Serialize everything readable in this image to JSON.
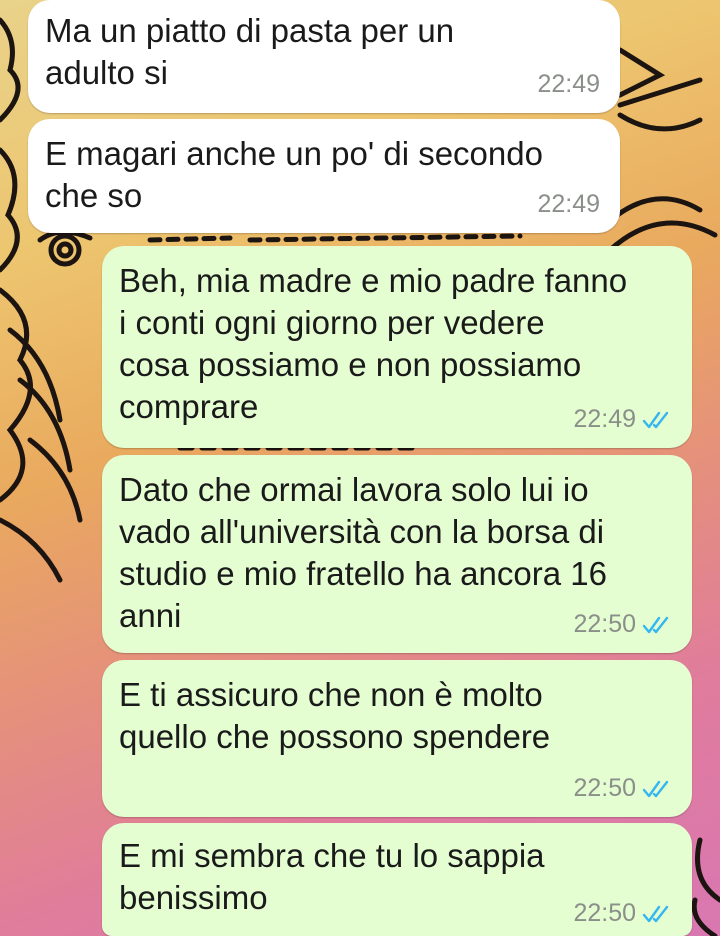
{
  "theme": {
    "incoming_bg": "#ffffff",
    "outgoing_bg": "#e4fdd1",
    "tick_color": "#34b7f1"
  },
  "messages": [
    {
      "direction": "in",
      "text": "Ma un piatto di pasta per un\nadulto si",
      "time": "22:49"
    },
    {
      "direction": "in",
      "text": "E magari anche un po' di secondo\nche so",
      "time": "22:49"
    },
    {
      "direction": "out",
      "text": "Beh, mia madre e mio padre fanno\ni conti ogni giorno per vedere\ncosa possiamo e non possiamo\ncomprare",
      "time": "22:49",
      "status_icon": "double-check-read-icon"
    },
    {
      "direction": "out",
      "text": "Dato che ormai lavora solo lui io\nvado all'università con la borsa di\nstudio e mio fratello ha ancora 16\nanni",
      "time": "22:50",
      "status_icon": "double-check-read-icon"
    },
    {
      "direction": "out",
      "text": "E ti assicuro che non è molto\nquello che possono spendere",
      "time": "22:50",
      "status_icon": "double-check-read-icon"
    },
    {
      "direction": "out",
      "text": "E mi sembra che tu lo sappia\nbenissimo",
      "time": "22:50",
      "status_icon": "double-check-read-icon"
    }
  ]
}
